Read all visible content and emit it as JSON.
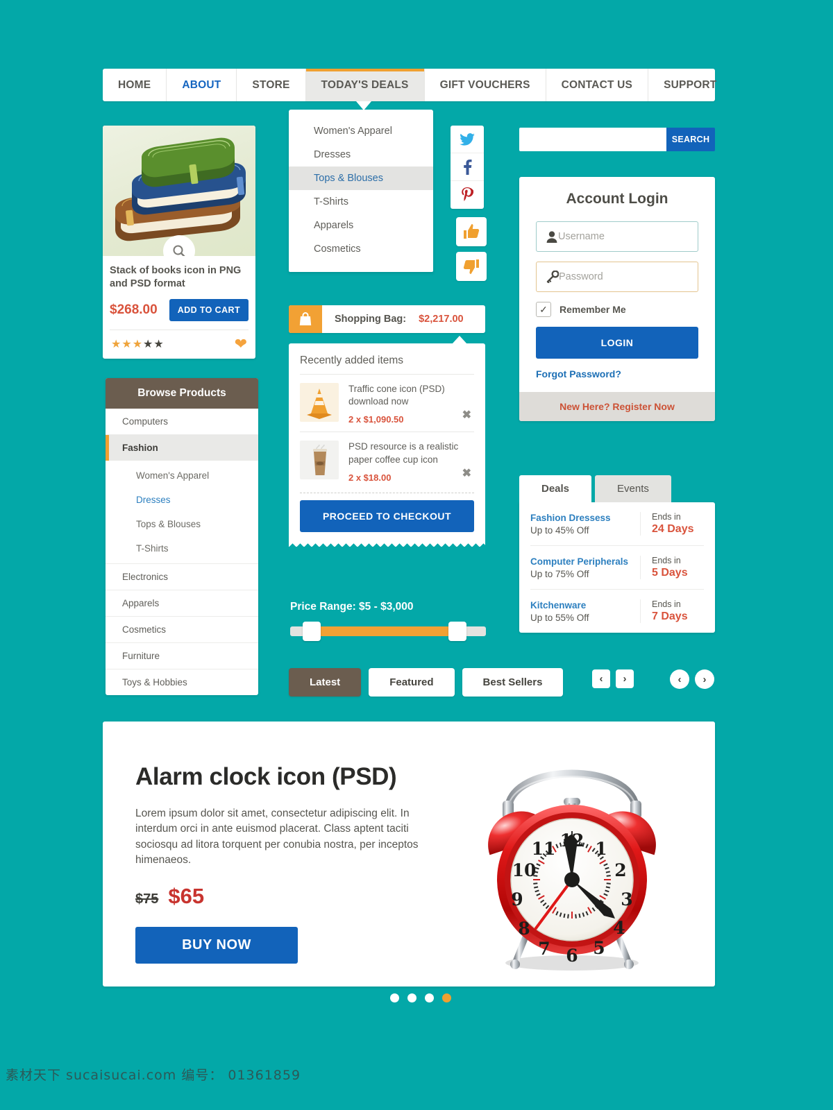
{
  "nav": {
    "items": [
      {
        "label": "HOME",
        "state": "normal"
      },
      {
        "label": "ABOUT",
        "state": "blue"
      },
      {
        "label": "STORE",
        "state": "normal"
      },
      {
        "label": "TODAY'S DEALS",
        "state": "active"
      },
      {
        "label": "GIFT VOUCHERS",
        "state": "normal"
      },
      {
        "label": "CONTACT US",
        "state": "normal"
      },
      {
        "label": "SUPPORT",
        "state": "normal"
      }
    ]
  },
  "dropdown": {
    "items": [
      {
        "label": "Women's Apparel",
        "selected": false
      },
      {
        "label": "Dresses",
        "selected": false
      },
      {
        "label": "Tops & Blouses",
        "selected": true
      },
      {
        "label": "T-Shirts",
        "selected": false
      },
      {
        "label": "Apparels",
        "selected": false
      },
      {
        "label": "Cosmetics",
        "selected": false
      }
    ]
  },
  "social": {
    "twitter": "twitter-icon",
    "facebook": "facebook-icon",
    "pinterest": "pinterest-icon",
    "thumb_up": "thumb-up-icon",
    "thumb_down": "thumb-down-icon"
  },
  "product_card": {
    "image_alt": "Stack of books icon",
    "title": "Stack of books icon in PNG and PSD format",
    "price": "$268.00",
    "add_to_cart_label": "ADD TO CART",
    "rating": 3,
    "rating_max": 5,
    "zoom_icon": "magnifier-icon",
    "wishlist_icon": "heart-icon"
  },
  "browse": {
    "heading": "Browse Products",
    "items": [
      {
        "label": "Computers",
        "type": "top",
        "state": "normal"
      },
      {
        "label": "Fashion",
        "type": "top",
        "state": "active"
      },
      {
        "label": "Women's Apparel",
        "type": "sub",
        "state": "normal"
      },
      {
        "label": "Dresses",
        "type": "sub",
        "state": "link"
      },
      {
        "label": "Tops & Blouses",
        "type": "sub",
        "state": "normal"
      },
      {
        "label": "T-Shirts",
        "type": "sub",
        "state": "normal"
      },
      {
        "label": "Electronics",
        "type": "top",
        "state": "normal"
      },
      {
        "label": "Apparels",
        "type": "top",
        "state": "normal"
      },
      {
        "label": "Cosmetics",
        "type": "top",
        "state": "normal"
      },
      {
        "label": "Furniture",
        "type": "top",
        "state": "normal"
      },
      {
        "label": "Toys & Hobbies",
        "type": "top",
        "state": "normal"
      }
    ]
  },
  "bag": {
    "icon": "shopping-bag-icon",
    "label": "Shopping Bag:",
    "total": "$2,217.00"
  },
  "receipt": {
    "title": "Recently added items",
    "items": [
      {
        "thumb": "traffic-cone-icon",
        "name": "Traffic cone icon (PSD) download now",
        "qty_price": "2 x $1,090.50",
        "remove_icon": "close-icon"
      },
      {
        "thumb": "coffee-cup-icon",
        "name": " PSD resource is a realistic paper coffee cup icon",
        "qty_price": "2 x $18.00",
        "remove_icon": "close-icon"
      }
    ],
    "checkout_label": "PROCEED TO CHECKOUT"
  },
  "price_range": {
    "label": "Price Range: $5 - $3,000",
    "min": "$5",
    "max": "$3,000"
  },
  "filter_tabs": {
    "tabs": [
      {
        "label": "Latest",
        "active": true
      },
      {
        "label": "Featured",
        "active": false
      },
      {
        "label": "Best Sellers",
        "active": false
      }
    ],
    "prev_square": "‹",
    "next_square": "›",
    "prev_round": "‹",
    "next_round": "›"
  },
  "search": {
    "value": "",
    "placeholder": "",
    "button_label": "SEARCH"
  },
  "login": {
    "title": "Account Login",
    "username": {
      "value": "",
      "placeholder": "Username",
      "icon": "user-icon"
    },
    "password": {
      "value": "",
      "placeholder": "Password",
      "icon": "key-icon"
    },
    "remember_label": "Remember Me",
    "remember_checked": true,
    "login_label": "LOGIN",
    "forgot_label": "Forgot Password?",
    "register_label": "New Here? Register Now"
  },
  "deals": {
    "tabs": [
      {
        "label": "Deals",
        "active": true
      },
      {
        "label": "Events",
        "active": false
      }
    ],
    "rows": [
      {
        "name": "Fashion Dressess",
        "offer": "Up to 45% Off",
        "ends_label": "Ends in",
        "days": "24 Days"
      },
      {
        "name": "Computer Peripherals",
        "offer": "Up to 75% Off",
        "ends_label": "Ends in",
        "days": "5 Days"
      },
      {
        "name": "Kitchenware",
        "offer": "Up to 55% Off",
        "ends_label": "Ends in",
        "days": "7 Days"
      }
    ]
  },
  "banner": {
    "title": "Alarm clock icon (PSD)",
    "description": "Lorem ipsum dolor sit amet, consectetur adipiscing elit. In interdum orci in ante euismod placerat. Class aptent taciti sociosqu ad litora torquent per conubia nostra, per inceptos himenaeos.",
    "old_price": "$75",
    "new_price": "$65",
    "buy_label": "BUY NOW",
    "image_alt": "red alarm clock",
    "dots": 4,
    "active_dot": 3
  },
  "watermark": {
    "text": "素材天下 sucaisucai.com  编号： 01361859"
  },
  "colors": {
    "background_teal": "#03a8a8",
    "accent_orange": "#f0a030",
    "primary_blue": "#1263ba",
    "link_blue": "#2c7fbf",
    "price_red": "#d9533c",
    "brown": "#6b5d4f"
  }
}
